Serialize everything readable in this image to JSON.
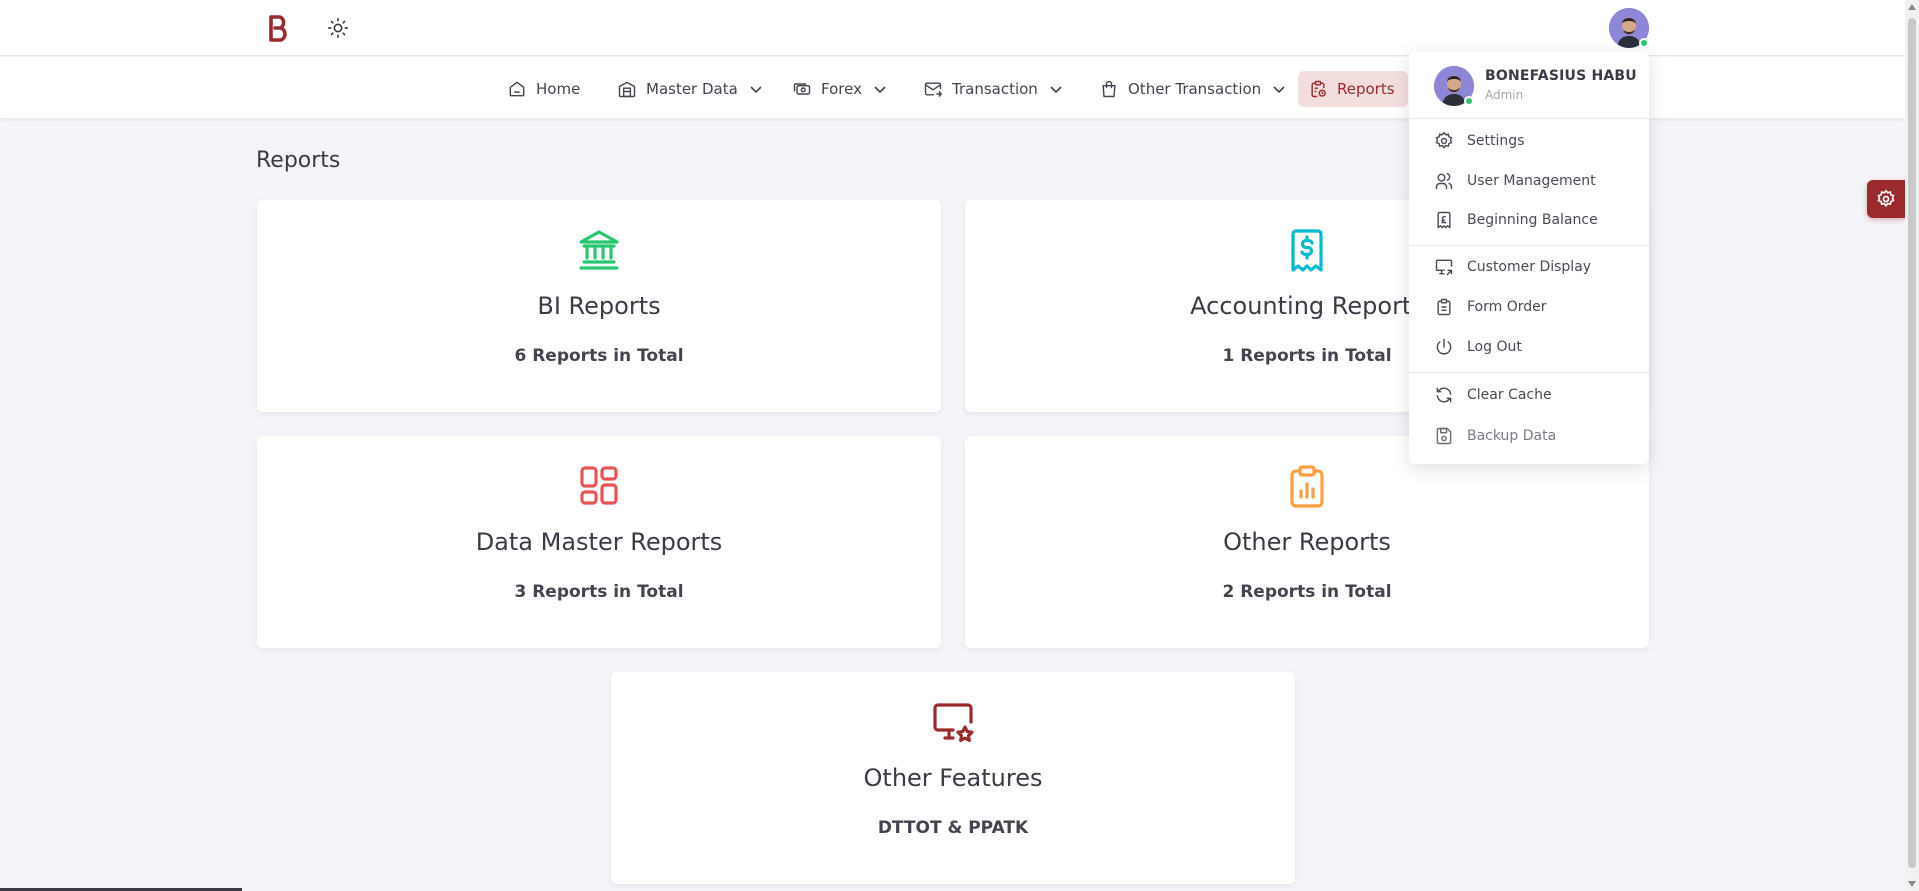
{
  "colors": {
    "brand": "#9b2a2f",
    "bi_icon": "#28c76f",
    "accounting_icon": "#00bad1",
    "data_master_icon": "#ea5455",
    "other_reports_icon": "#ff9f43",
    "other_features_icon": "#9b2a2f",
    "online": "#28c76f"
  },
  "topbar": {
    "logo_icon": "brand-b-logo",
    "theme_icon": "sun-icon",
    "avatar_icon": "user-avatar"
  },
  "nav": {
    "items": [
      {
        "label": "Home",
        "icon": "home-icon",
        "dropdown": false
      },
      {
        "label": "Master Data",
        "icon": "building-icon",
        "dropdown": true
      },
      {
        "label": "Forex",
        "icon": "currency-exchange-icon",
        "dropdown": true
      },
      {
        "label": "Transaction",
        "icon": "mail-transfer-icon",
        "dropdown": true
      },
      {
        "label": "Other Transaction",
        "icon": "shopping-bag-icon",
        "dropdown": true
      },
      {
        "label": "Reports",
        "icon": "clipboard-report-icon",
        "dropdown": false,
        "active": true
      }
    ]
  },
  "page": {
    "title": "Reports"
  },
  "cards": [
    {
      "title": "BI Reports",
      "subtitle": "6 Reports in Total",
      "icon": "bank-icon"
    },
    {
      "title": "Accounting Reports",
      "subtitle": "1 Reports in Total",
      "icon": "receipt-dollar-icon"
    },
    {
      "title": "Data Master Reports",
      "subtitle": "3 Reports in Total",
      "icon": "dashboard-layout-icon"
    },
    {
      "title": "Other Reports",
      "subtitle": "2 Reports in Total",
      "icon": "clipboard-chart-icon"
    },
    {
      "title": "Other Features",
      "subtitle": "DTTOT & PPATK",
      "icon": "monitor-star-icon"
    }
  ],
  "user_menu": {
    "name": "BONEFASIUS HABU",
    "role": "Admin",
    "items": [
      {
        "label": "Settings",
        "icon": "settings-icon"
      },
      {
        "label": "User Management",
        "icon": "users-icon"
      },
      {
        "label": "Beginning Balance",
        "icon": "receipt-pound-icon"
      },
      {
        "label": "Customer Display",
        "icon": "monitor-share-icon"
      },
      {
        "label": "Form Order",
        "icon": "clipboard-text-icon"
      },
      {
        "label": "Log Out",
        "icon": "power-icon"
      },
      {
        "label": "Clear Cache",
        "icon": "refresh-icon"
      },
      {
        "label": "Backup Data",
        "icon": "save-icon"
      }
    ]
  },
  "customizer": {
    "icon": "settings-icon"
  }
}
